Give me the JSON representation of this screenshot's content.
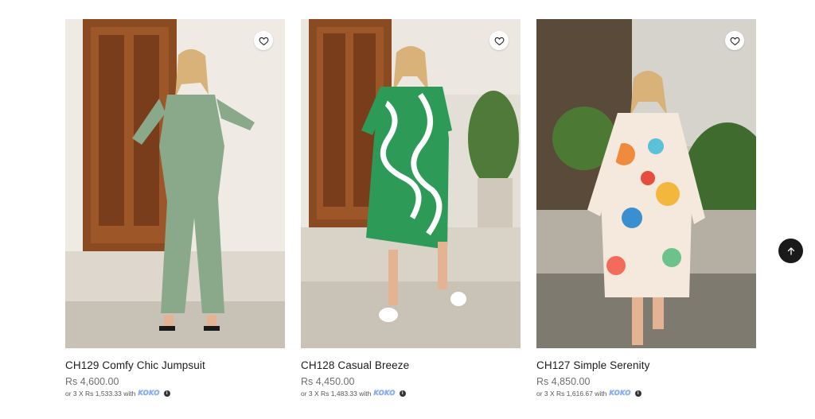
{
  "products": [
    {
      "title": "CH129 Comfy Chic Jumpsuit",
      "price": "Rs 4,600.00",
      "installment_text": "or 3 X Rs 1,533.33 with",
      "installment_brand": "KOKO",
      "garment_color": "#8aa98a"
    },
    {
      "title": "CH128 Casual Breeze",
      "price": "Rs 4,450.00",
      "installment_text": "or 3 X Rs 1,483.33 with",
      "installment_brand": "KOKO",
      "garment_color": "#2e9a57"
    },
    {
      "title": "CH127 Simple Serenity",
      "price": "Rs 4,850.00",
      "installment_text": "or 3 X Rs 1,616.67 with",
      "installment_brand": "KOKO",
      "garment_color": "#f5e9dd"
    }
  ],
  "icons": {
    "wishlist": "heart-icon",
    "info": "info-icon",
    "scroll_top": "arrow-up-icon"
  },
  "info_glyph": "i"
}
